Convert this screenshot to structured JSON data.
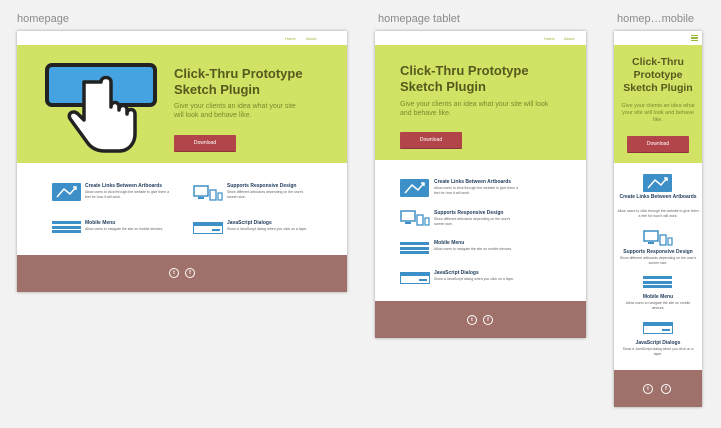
{
  "artboards": {
    "desktop": {
      "label": "homepage"
    },
    "tablet": {
      "label": "homepage tablet"
    },
    "mobile": {
      "label": "homep…mobile"
    }
  },
  "nav": {
    "home": "Home",
    "about": "About"
  },
  "hero": {
    "title_line1": "Click-Thru Prototype",
    "title_line2": "Sketch Plugin",
    "subtitle": "Give your clients an idea what your site will look and behave like.",
    "button": "Download"
  },
  "features": [
    {
      "icon": "arrows-icon",
      "title": "Create Links Between Artboards",
      "desc": "Allow users to click through the website to give them a feel for how it will work."
    },
    {
      "icon": "devices-icon",
      "title": "Supports Responsive Design",
      "desc": "Show different artboards depending on the user's screen size."
    },
    {
      "icon": "menu-icon",
      "title": "Mobile Menu",
      "desc": "Allow users to navigate the site on mobile devices."
    },
    {
      "icon": "dialog-icon",
      "title": "JavaScript Dialogs",
      "desc": "Show a JavaScript dialog when you click on a layer."
    }
  ],
  "footer": {
    "twitter": "t",
    "facebook": "f"
  },
  "colors": {
    "hero": "#d2e264",
    "button": "#b1454a",
    "footer": "#a0706b",
    "accent": "#3d8fc7"
  }
}
